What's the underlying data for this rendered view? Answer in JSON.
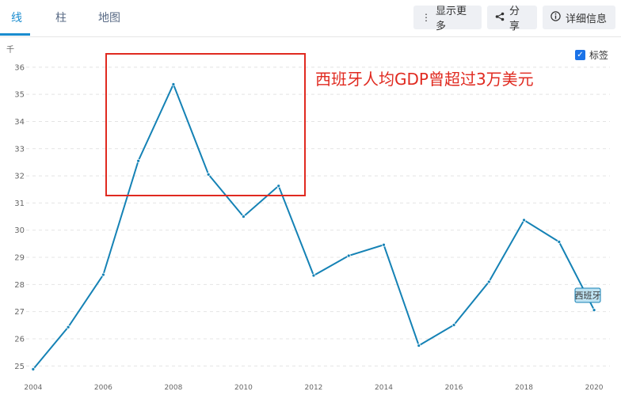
{
  "tabs": [
    {
      "label": "线",
      "active": true
    },
    {
      "label": "柱",
      "active": false
    },
    {
      "label": "地图",
      "active": false
    }
  ],
  "toolbar": {
    "more_label": "显示更多",
    "share_label": "分享",
    "details_label": "详细信息"
  },
  "legend_toggle": {
    "label": "标签",
    "checked": true
  },
  "annotation": {
    "text": "西班牙人均GDP曾超过3万美元",
    "color": "#e02a20"
  },
  "chart_data": {
    "type": "line",
    "ylabel": "千",
    "ylim": [
      24.6,
      36.2
    ],
    "yticks": [
      25,
      26,
      27,
      28,
      29,
      30,
      31,
      32,
      33,
      34,
      35,
      36
    ],
    "xticks": [
      2004,
      2006,
      2008,
      2010,
      2012,
      2014,
      2016,
      2018,
      2020
    ],
    "grid": true,
    "series": [
      {
        "name": "西班牙",
        "color": "#1582b5",
        "x": [
          2004,
          2005,
          2006,
          2007,
          2008,
          2009,
          2010,
          2011,
          2012,
          2013,
          2014,
          2015,
          2016,
          2017,
          2018,
          2019,
          2020
        ],
        "y": [
          24.88,
          26.43,
          28.36,
          32.55,
          35.37,
          32.05,
          30.5,
          31.63,
          28.33,
          29.06,
          29.46,
          25.75,
          26.51,
          28.1,
          30.37,
          29.57,
          27.06
        ]
      }
    ]
  }
}
